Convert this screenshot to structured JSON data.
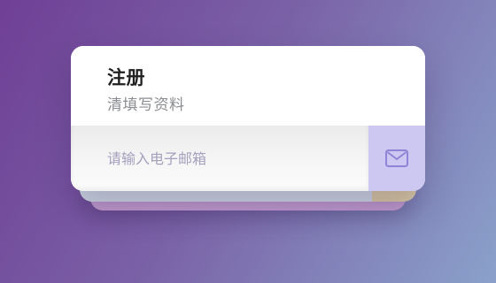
{
  "form": {
    "title": "注册",
    "subtitle": "清填写资料",
    "email_placeholder": "请输入电子邮箱",
    "email_value": "",
    "email_icon": "mail-icon"
  },
  "colors": {
    "background_start": "#6f3f96",
    "background_end": "#8aa1cb",
    "card": "#ffffff",
    "icon_cell": "#cdc8f2",
    "icon_stroke": "#8f84d8",
    "title": "#202020",
    "subtitle": "#8a8d91",
    "placeholder": "#a59fbd"
  }
}
